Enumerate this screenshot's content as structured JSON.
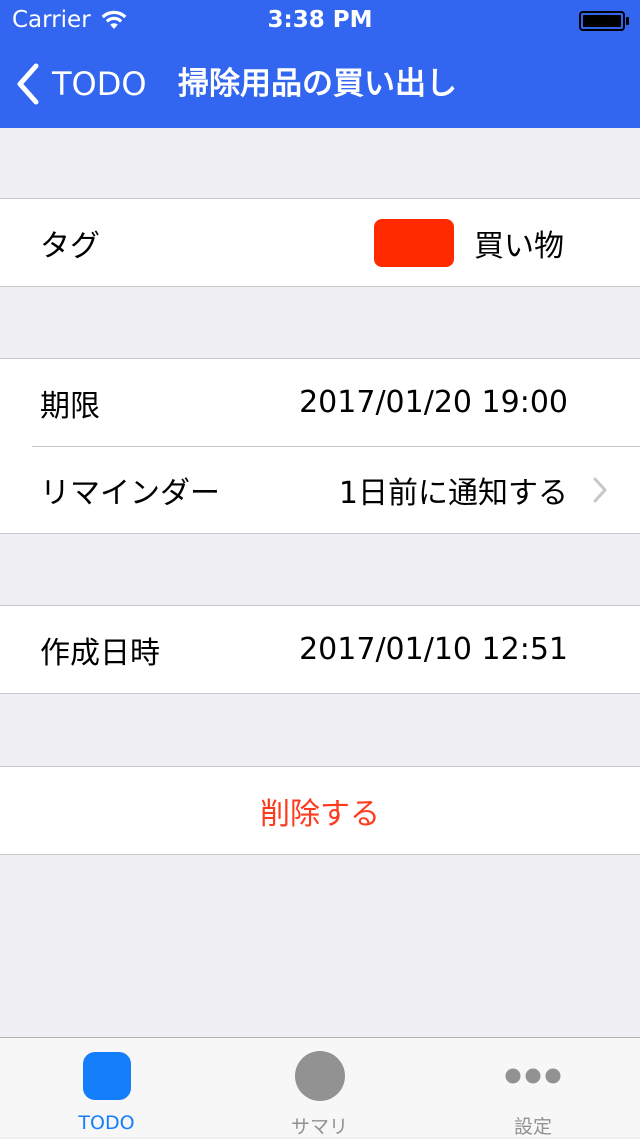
{
  "status_bar": {
    "carrier": "Carrier",
    "time": "3:38 PM",
    "icons": [
      "wifi-icon",
      "battery-icon"
    ]
  },
  "nav": {
    "back_label": "TODO",
    "title": "掃除用品の買い出し",
    "background_color": "#3366f0"
  },
  "sections": {
    "tag": {
      "label": "タグ",
      "color": "#ff2a00",
      "name": "買い物"
    },
    "schedule": {
      "deadline_label": "期限",
      "deadline_value": "2017/01/20 19:00",
      "reminder_label": "リマインダー",
      "reminder_value": "1日前に通知する"
    },
    "created": {
      "label": "作成日時",
      "value": "2017/01/10 12:51"
    },
    "delete": {
      "label": "削除する",
      "color": "#ff3b1f"
    }
  },
  "tab_bar": {
    "tabs": [
      {
        "label": "TODO",
        "icon": "rounded-square-icon",
        "selected": true,
        "color": "#147efb"
      },
      {
        "label": "サマリ",
        "icon": "circle-icon",
        "selected": false,
        "color": "#929292"
      },
      {
        "label": "設定",
        "icon": "more-dots-icon",
        "selected": false,
        "color": "#929292"
      }
    ]
  }
}
